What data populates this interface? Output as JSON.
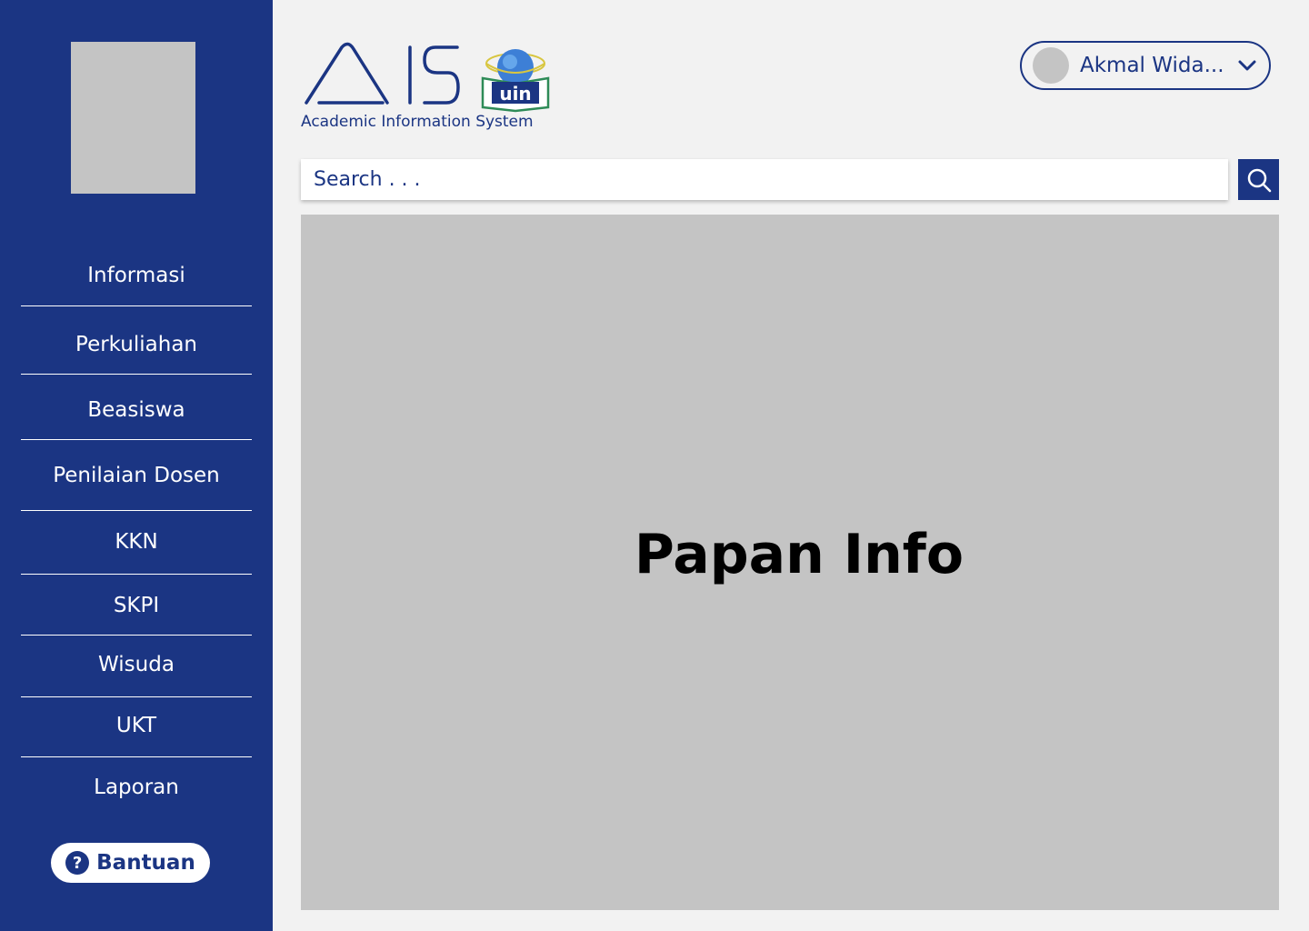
{
  "sidebar": {
    "items": [
      {
        "label": "Informasi"
      },
      {
        "label": "Perkuliahan"
      },
      {
        "label": "Beasiswa"
      },
      {
        "label": "Penilaian Dosen"
      },
      {
        "label": "KKN"
      },
      {
        "label": "SKPI"
      },
      {
        "label": "Wisuda"
      },
      {
        "label": "UKT"
      },
      {
        "label": "Laporan"
      }
    ],
    "help_label": "Bantuan",
    "help_icon_glyph": "?"
  },
  "header": {
    "logo_text": "AIS",
    "logo_badge": "uin",
    "logo_caption": "Academic Information System",
    "user_name": "Akmal Wida..."
  },
  "search": {
    "placeholder": "Search . . .",
    "value": ""
  },
  "main": {
    "board_title": "Papan Info"
  },
  "colors": {
    "primary": "#1b3583",
    "placeholder_gray": "#c4c4c4",
    "background": "#f2f2f2"
  },
  "icons": {
    "search": "search-icon",
    "user_dropdown": "chevron-down-icon",
    "help": "help-circle-icon"
  }
}
